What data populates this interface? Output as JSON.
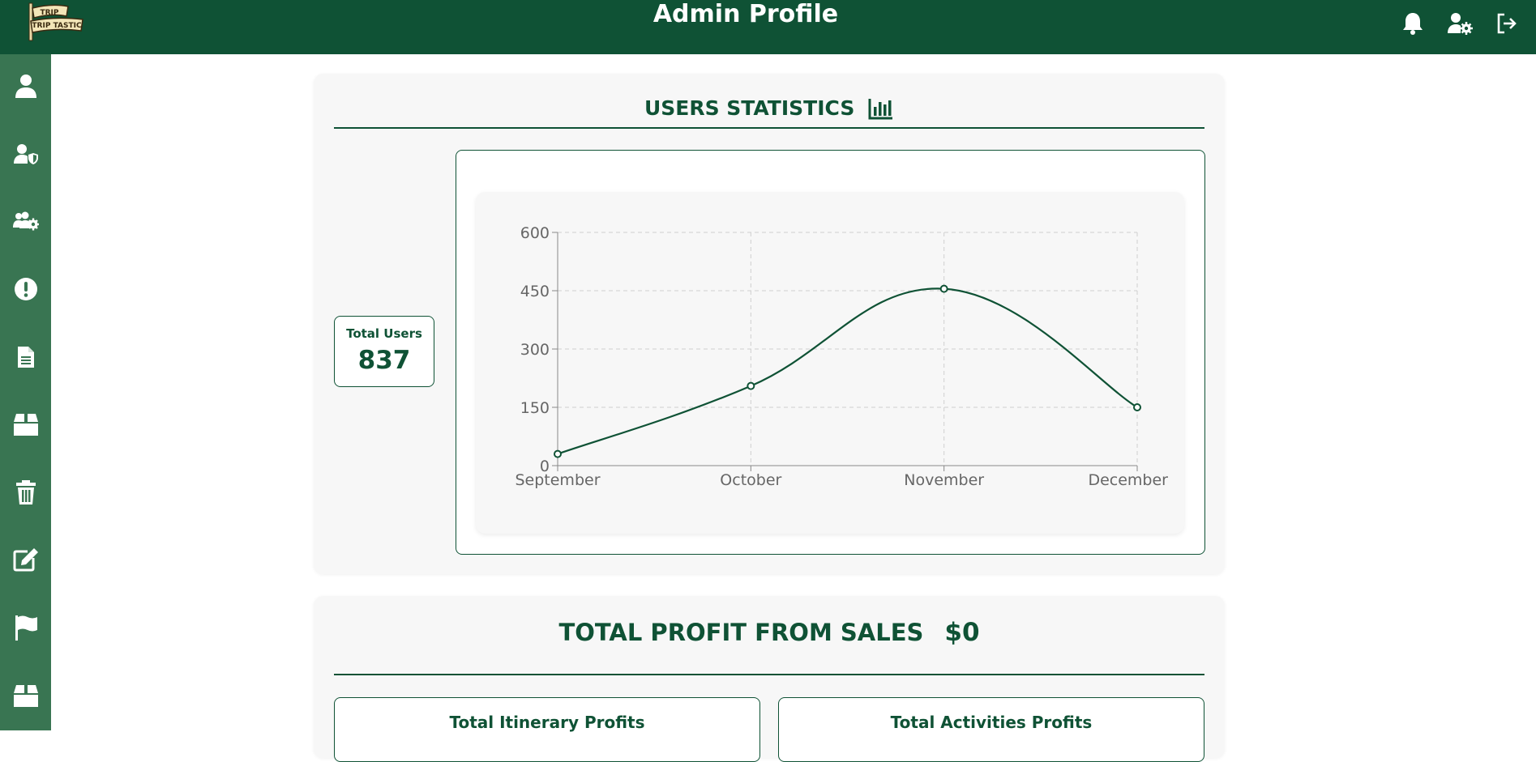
{
  "header": {
    "logo_text_top": "TRIP",
    "logo_text_bottom": "TRIP TASTIC",
    "title": "Admin Profile",
    "icons": [
      "bell-icon",
      "user-gear-icon",
      "logout-icon"
    ]
  },
  "sidebar": {
    "items": [
      "user-icon",
      "user-shield-icon",
      "users-gear-icon",
      "exclamation-circle-icon",
      "document-icon",
      "box-icon",
      "trash-icon",
      "edit-icon",
      "flag-icon",
      "box-icon"
    ]
  },
  "stats": {
    "title": "USERS STATISTICS",
    "total_users_label": "Total Users",
    "total_users_value": "837"
  },
  "profit": {
    "title": "TOTAL PROFIT FROM SALES",
    "value": "$0",
    "itinerary_label": "Total Itinerary Profits",
    "activities_label": "Total Activities Profits"
  },
  "colors": {
    "brand": "#0f5235",
    "sidebar": "#397552"
  },
  "chart_data": {
    "type": "line",
    "categories": [
      "September",
      "October",
      "November",
      "December"
    ],
    "values": [
      30,
      205,
      455,
      150
    ],
    "ylim": [
      0,
      600
    ],
    "yticks": [
      "0",
      "150",
      "300",
      "450",
      "600"
    ],
    "grid": true,
    "smooth": true
  }
}
